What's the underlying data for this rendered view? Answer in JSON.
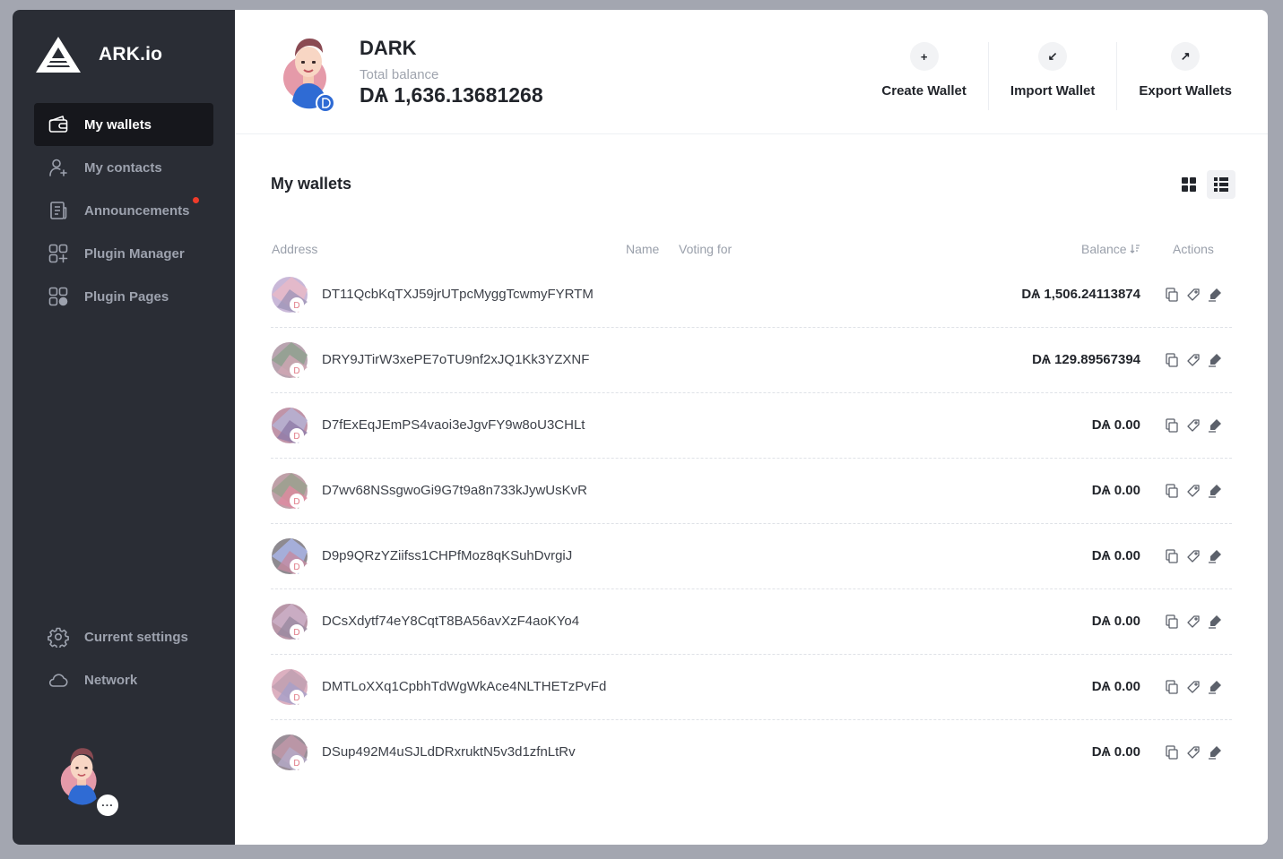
{
  "app": {
    "brand": "ARK.io"
  },
  "sidebar": {
    "items": [
      {
        "label": "My wallets",
        "icon": "wallet-icon",
        "active": true
      },
      {
        "label": "My contacts",
        "icon": "contacts-icon",
        "active": false
      },
      {
        "label": "Announcements",
        "icon": "announcements-icon",
        "active": false,
        "notification": true
      },
      {
        "label": "Plugin Manager",
        "icon": "plugin-manager-icon",
        "active": false
      },
      {
        "label": "Plugin Pages",
        "icon": "plugin-pages-icon",
        "active": false
      }
    ],
    "bottom_items": [
      {
        "label": "Current settings",
        "icon": "settings-icon"
      },
      {
        "label": "Network",
        "icon": "cloud-icon"
      }
    ],
    "more_label": "···"
  },
  "header": {
    "profile_name": "DARK",
    "balance_label": "Total balance",
    "balance_value": "DѦ 1,636.13681268",
    "actions": [
      {
        "label": "Create Wallet",
        "icon": "plus-icon",
        "glyph": "+"
      },
      {
        "label": "Import Wallet",
        "icon": "import-icon",
        "glyph": "↙"
      },
      {
        "label": "Export Wallets",
        "icon": "export-icon",
        "glyph": "↗"
      }
    ]
  },
  "main": {
    "title": "My wallets",
    "view_modes": [
      "grid-view",
      "list-view"
    ],
    "active_view": "list-view",
    "columns": {
      "address": "Address",
      "name": "Name",
      "voting": "Voting for",
      "balance": "Balance",
      "actions": "Actions"
    },
    "wallets": [
      {
        "address": "DT11QcbKqTXJ59jrUTpcMyggTcwmyFYRTM",
        "balance": "DѦ 1,506.24113874"
      },
      {
        "address": "DRY9JTirW3xePE7oTU9nf2xJQ1Kk3YZXNF",
        "balance": "DѦ 129.89567394"
      },
      {
        "address": "D7fExEqJEmPS4vaoi3eJgvFY9w8oU3CHLt",
        "balance": "DѦ 0.00"
      },
      {
        "address": "D7wv68NSsgwoGi9G7t9a8n733kJywUsKvR",
        "balance": "DѦ 0.00"
      },
      {
        "address": "D9p9QRzYZiifss1CHPfMoz8qKSuhDvrgiJ",
        "balance": "DѦ 0.00"
      },
      {
        "address": "DCsXdytf74eY8CqtT8BA56avXzF4aoKYo4",
        "balance": "DѦ 0.00"
      },
      {
        "address": "DMTLoXXq1CpbhTdWgWkAce4NLTHETzPvFd",
        "balance": "DѦ 0.00"
      },
      {
        "address": "DSup492M4uSJLdDRxruktN5v3d1zfnLtRv",
        "balance": "DѦ 0.00"
      }
    ],
    "row_actions": [
      "copy-icon",
      "tag-icon",
      "sign-icon"
    ]
  },
  "colors": {
    "sidebar_bg": "#2a2d35",
    "active_item_bg": "#16171c",
    "notification_dot": "#ef3b2a",
    "text_primary": "#22252b",
    "text_muted": "#9aa0ab"
  }
}
